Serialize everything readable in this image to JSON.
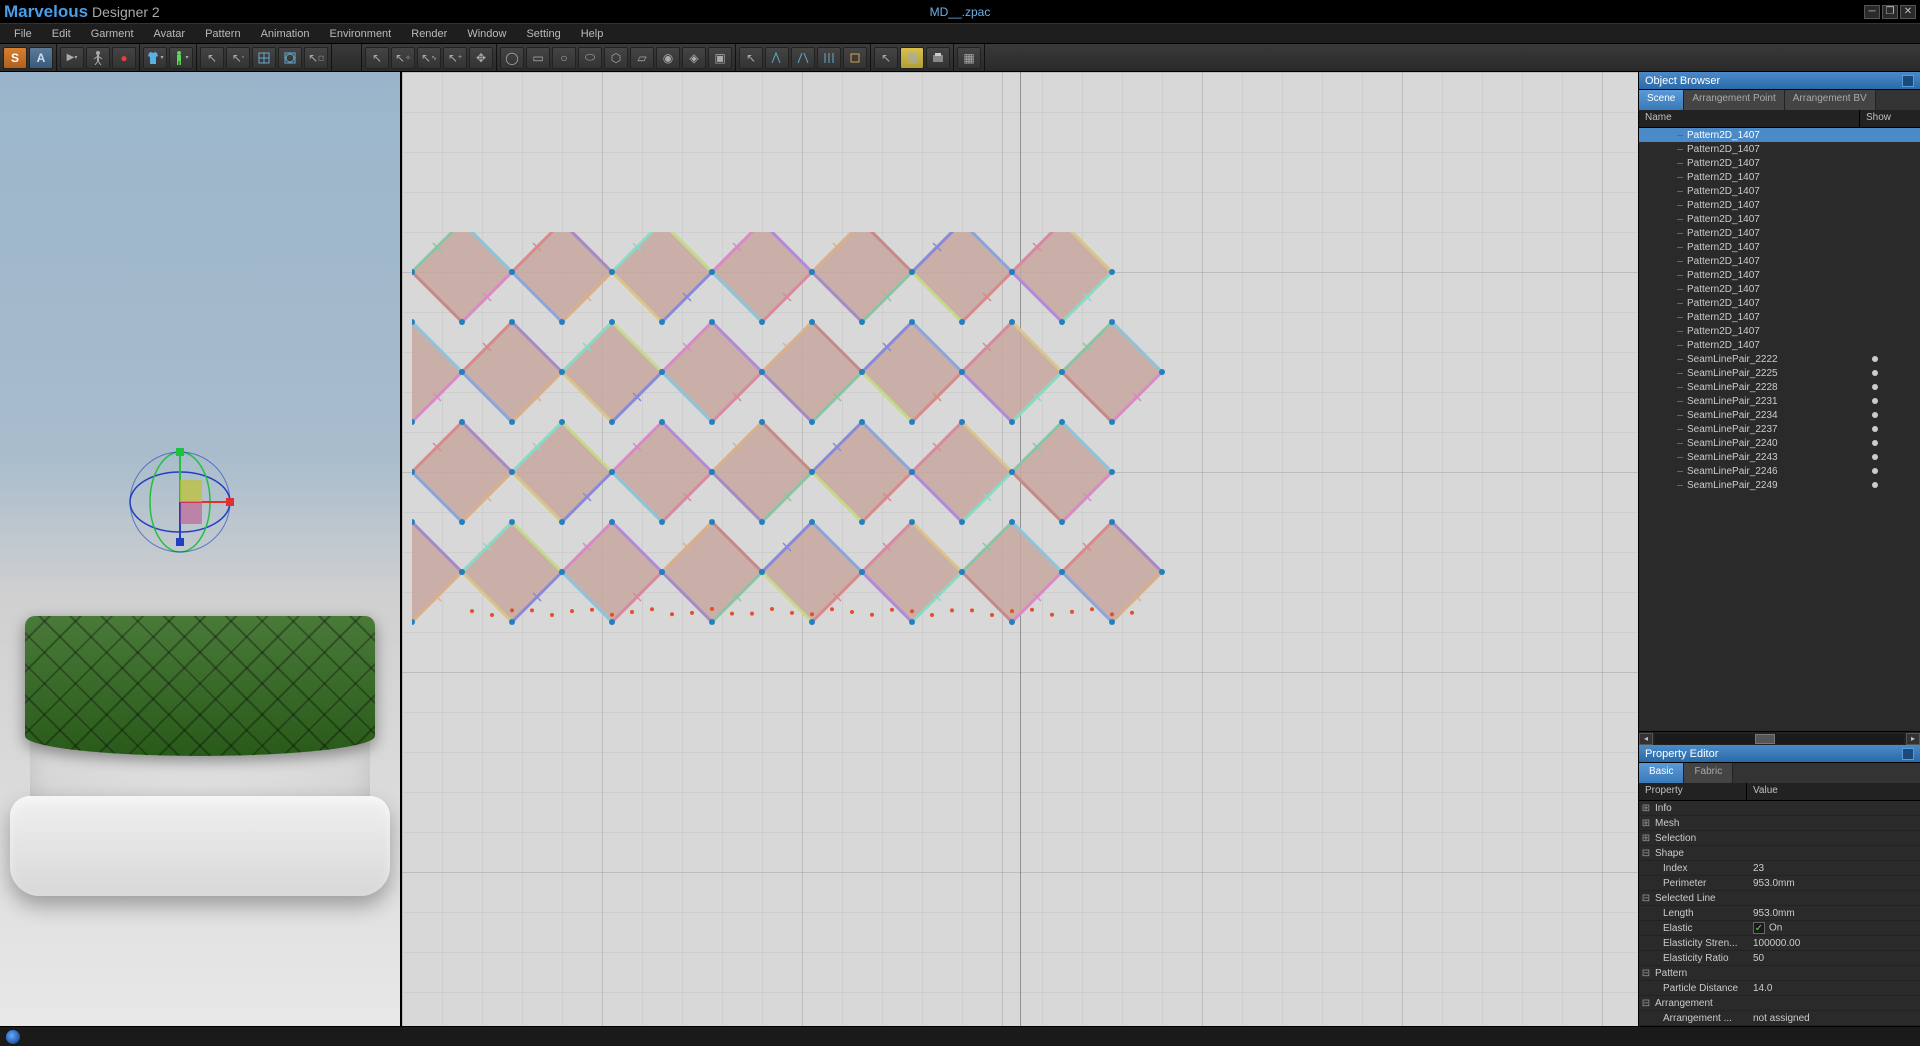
{
  "app": {
    "title_marvelous": "Marvelous",
    "title_designer": " Designer 2",
    "document": "MD__.zpac"
  },
  "menu": [
    "File",
    "Edit",
    "Garment",
    "Avatar",
    "Pattern",
    "Animation",
    "Environment",
    "Render",
    "Window",
    "Setting",
    "Help"
  ],
  "toolbar": {
    "sync": "S",
    "avatar": "A",
    "play": "▶",
    "pause": "❚❚",
    "person": "⇡",
    "rec": "●"
  },
  "object_browser": {
    "title": "Object Browser",
    "tabs": [
      "Scene",
      "Arrangement Point",
      "Arrangement BV"
    ],
    "active_tab": 0,
    "columns": {
      "name": "Name",
      "show": "Show"
    },
    "items": [
      {
        "label": "Pattern2D_1407",
        "sel": true,
        "show": false
      },
      {
        "label": "Pattern2D_1407",
        "sel": false,
        "show": false
      },
      {
        "label": "Pattern2D_1407",
        "sel": false,
        "show": false
      },
      {
        "label": "Pattern2D_1407",
        "sel": false,
        "show": false
      },
      {
        "label": "Pattern2D_1407",
        "sel": false,
        "show": false
      },
      {
        "label": "Pattern2D_1407",
        "sel": false,
        "show": false
      },
      {
        "label": "Pattern2D_1407",
        "sel": false,
        "show": false
      },
      {
        "label": "Pattern2D_1407",
        "sel": false,
        "show": false
      },
      {
        "label": "Pattern2D_1407",
        "sel": false,
        "show": false
      },
      {
        "label": "Pattern2D_1407",
        "sel": false,
        "show": false
      },
      {
        "label": "Pattern2D_1407",
        "sel": false,
        "show": false
      },
      {
        "label": "Pattern2D_1407",
        "sel": false,
        "show": false
      },
      {
        "label": "Pattern2D_1407",
        "sel": false,
        "show": false
      },
      {
        "label": "Pattern2D_1407",
        "sel": false,
        "show": false
      },
      {
        "label": "Pattern2D_1407",
        "sel": false,
        "show": false
      },
      {
        "label": "Pattern2D_1407",
        "sel": false,
        "show": false
      },
      {
        "label": "SeamLinePair_2222",
        "sel": false,
        "show": true
      },
      {
        "label": "SeamLinePair_2225",
        "sel": false,
        "show": true
      },
      {
        "label": "SeamLinePair_2228",
        "sel": false,
        "show": true
      },
      {
        "label": "SeamLinePair_2231",
        "sel": false,
        "show": true
      },
      {
        "label": "SeamLinePair_2234",
        "sel": false,
        "show": true
      },
      {
        "label": "SeamLinePair_2237",
        "sel": false,
        "show": true
      },
      {
        "label": "SeamLinePair_2240",
        "sel": false,
        "show": true
      },
      {
        "label": "SeamLinePair_2243",
        "sel": false,
        "show": true
      },
      {
        "label": "SeamLinePair_2246",
        "sel": false,
        "show": true
      },
      {
        "label": "SeamLinePair_2249",
        "sel": false,
        "show": true
      }
    ]
  },
  "property_editor": {
    "title": "Property Editor",
    "tabs": [
      "Basic",
      "Fabric"
    ],
    "active_tab": 0,
    "columns": {
      "property": "Property",
      "value": "Value"
    },
    "groups": [
      {
        "exp": "+",
        "label": "Info",
        "value": ""
      },
      {
        "exp": "+",
        "label": "Mesh",
        "value": ""
      },
      {
        "exp": "+",
        "label": "Selection",
        "value": ""
      },
      {
        "exp": "-",
        "label": "Shape",
        "value": ""
      },
      {
        "sub": true,
        "label": "Index",
        "value": "23"
      },
      {
        "sub": true,
        "label": "Perimeter",
        "value": "953.0mm"
      },
      {
        "exp": "-",
        "label": "Selected Line",
        "value": ""
      },
      {
        "sub": true,
        "label": "Length",
        "value": "953.0mm"
      },
      {
        "sub": true,
        "label": "Elastic",
        "value": "On",
        "check": true
      },
      {
        "sub": true,
        "label": "Elasticity Stren...",
        "value": "100000.00"
      },
      {
        "sub": true,
        "label": "Elasticity Ratio",
        "value": "50"
      },
      {
        "exp": "-",
        "label": "Pattern",
        "value": ""
      },
      {
        "sub": true,
        "label": "Particle Distance",
        "value": "14.0"
      },
      {
        "exp": "-",
        "label": "Arrangement",
        "value": ""
      },
      {
        "sub": true,
        "label": "Arrangement ...",
        "value": "not assigned"
      }
    ]
  },
  "diamond_colors": [
    "#8bc5d9",
    "#d989c5",
    "#c58989",
    "#89c5a5",
    "#a589c5",
    "#d9b089",
    "#89a5d9",
    "#d98989",
    "#c5d989",
    "#8989d9",
    "#d9c589",
    "#89d9c5",
    "#b089d9",
    "#d9899f"
  ]
}
